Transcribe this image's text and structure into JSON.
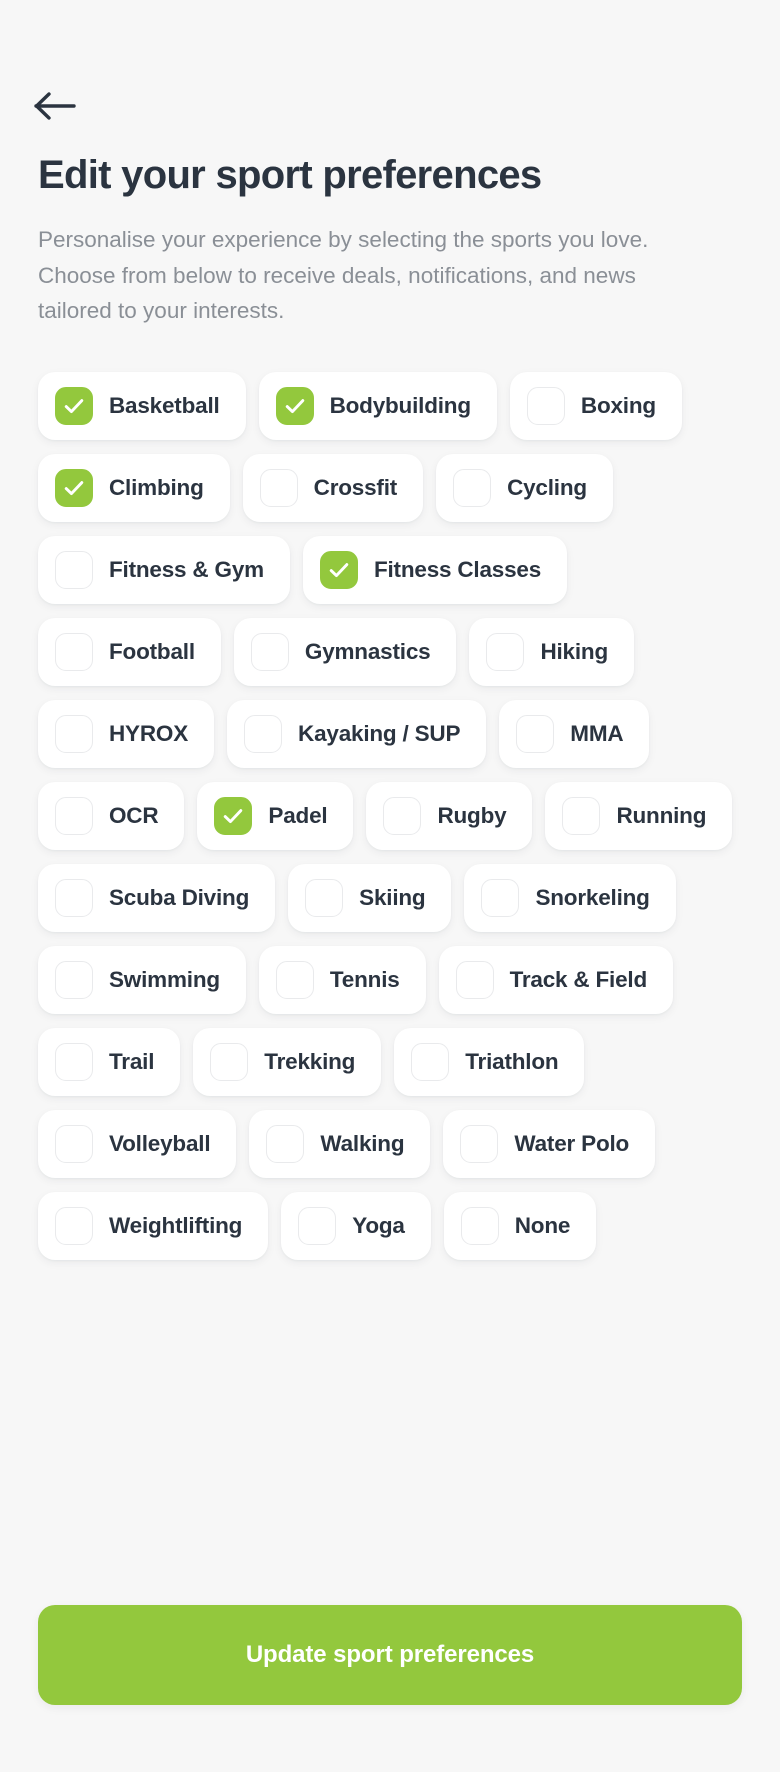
{
  "header": {
    "back_icon": "arrow-left-icon",
    "title": "Edit your sport preferences",
    "description": "Personalise your experience by selecting the sports you love. Choose from below to receive deals, notifications, and news tailored to your interests."
  },
  "colors": {
    "accent_green": "#93c83d",
    "page_background": "#f7f7f7",
    "chip_background": "#ffffff",
    "text_primary": "#2b3440",
    "text_muted": "#8a8f96",
    "checkbox_border": "#e9eaec"
  },
  "sports": [
    {
      "label": "Basketball",
      "checked": true
    },
    {
      "label": "Bodybuilding",
      "checked": true
    },
    {
      "label": "Boxing",
      "checked": false
    },
    {
      "label": "Climbing",
      "checked": true
    },
    {
      "label": "Crossfit",
      "checked": false
    },
    {
      "label": "Cycling",
      "checked": false
    },
    {
      "label": "Fitness & Gym",
      "checked": false
    },
    {
      "label": "Fitness Classes",
      "checked": true
    },
    {
      "label": "Football",
      "checked": false
    },
    {
      "label": "Gymnastics",
      "checked": false
    },
    {
      "label": "Hiking",
      "checked": false
    },
    {
      "label": "HYROX",
      "checked": false
    },
    {
      "label": "Kayaking / SUP",
      "checked": false
    },
    {
      "label": "MMA",
      "checked": false
    },
    {
      "label": "OCR",
      "checked": false
    },
    {
      "label": "Padel",
      "checked": true
    },
    {
      "label": "Rugby",
      "checked": false
    },
    {
      "label": "Running",
      "checked": false
    },
    {
      "label": "Scuba Diving",
      "checked": false
    },
    {
      "label": "Skiing",
      "checked": false
    },
    {
      "label": "Snorkeling",
      "checked": false
    },
    {
      "label": "Swimming",
      "checked": false
    },
    {
      "label": "Tennis",
      "checked": false
    },
    {
      "label": "Track & Field",
      "checked": false
    },
    {
      "label": "Trail",
      "checked": false
    },
    {
      "label": "Trekking",
      "checked": false
    },
    {
      "label": "Triathlon",
      "checked": false
    },
    {
      "label": "Volleyball",
      "checked": false
    },
    {
      "label": "Walking",
      "checked": false
    },
    {
      "label": "Water Polo",
      "checked": false
    },
    {
      "label": "Weightlifting",
      "checked": false
    },
    {
      "label": "Yoga",
      "checked": false
    },
    {
      "label": "None",
      "checked": false
    }
  ],
  "footer": {
    "submit_label": "Update sport preferences"
  }
}
